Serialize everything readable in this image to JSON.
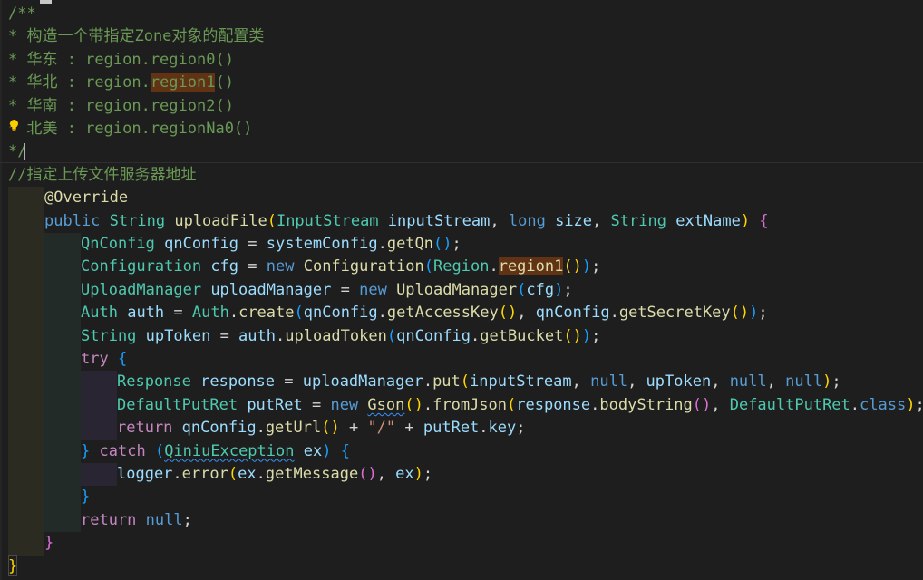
{
  "colors": {
    "background": "#1e1e1e",
    "comment": "#6a9955",
    "keyword": "#569cd6",
    "control": "#c586c0",
    "type": "#4ec9b0",
    "function": "#dcdcaa",
    "variable": "#9cdcfe",
    "string": "#ce9178",
    "bracket_1": "#ffd700",
    "bracket_2": "#da70d6",
    "bracket_3": "#179fff",
    "highlight": "#613214"
  },
  "icons": {
    "lightbulb": "lightbulb-icon",
    "cursor": "text-cursor"
  },
  "code": {
    "lines": [
      {
        "i": 0,
        "tokens": [
          {
            "t": "/**",
            "c": "comment"
          }
        ]
      },
      {
        "i": 0,
        "tokens": [
          {
            "t": "* 构造一个带指定Zone对象的配置类",
            "c": "comment"
          }
        ]
      },
      {
        "i": 0,
        "tokens": [
          {
            "t": "* 华东 : region.region0()",
            "c": "comment"
          }
        ]
      },
      {
        "i": 0,
        "tokens": [
          {
            "t": "* 华北 : region.",
            "c": "comment"
          },
          {
            "t": "region1",
            "c": "comment",
            "hl": true
          },
          {
            "t": "()",
            "c": "comment"
          }
        ]
      },
      {
        "i": 0,
        "tokens": [
          {
            "t": "* 华南 : region.region2()",
            "c": "comment"
          }
        ]
      },
      {
        "i": 0,
        "tokens": [
          {
            "t": "* 北美 : region.regionNa0()",
            "c": "comment"
          }
        ]
      },
      {
        "i": 0,
        "tokens": [
          {
            "t": "*/",
            "c": "comment"
          }
        ]
      },
      {
        "i": 0,
        "tokens": [
          {
            "t": "//指定上传文件服务器地址",
            "c": "comment"
          }
        ]
      },
      {
        "i": 1,
        "tokens": [
          {
            "t": "@Override",
            "c": "anno"
          }
        ]
      },
      {
        "i": 1,
        "tokens": [
          {
            "t": "public",
            "c": "kw"
          },
          {
            "t": " "
          },
          {
            "t": "String",
            "c": "type"
          },
          {
            "t": " "
          },
          {
            "t": "uploadFile",
            "c": "fn"
          },
          {
            "t": "(",
            "c": "p1"
          },
          {
            "t": "InputStream",
            "c": "type"
          },
          {
            "t": " "
          },
          {
            "t": "inputStream",
            "c": "var"
          },
          {
            "t": ", "
          },
          {
            "t": "long",
            "c": "kw"
          },
          {
            "t": " "
          },
          {
            "t": "size",
            "c": "var"
          },
          {
            "t": ", "
          },
          {
            "t": "String",
            "c": "type"
          },
          {
            "t": " "
          },
          {
            "t": "extName",
            "c": "var"
          },
          {
            "t": ")",
            "c": "p1"
          },
          {
            "t": " "
          },
          {
            "t": "{",
            "c": "p2"
          }
        ]
      },
      {
        "i": 2,
        "tokens": [
          {
            "t": "QnConfig",
            "c": "type"
          },
          {
            "t": " "
          },
          {
            "t": "qnConfig",
            "c": "var"
          },
          {
            "t": " = "
          },
          {
            "t": "systemConfig",
            "c": "var"
          },
          {
            "t": "."
          },
          {
            "t": "getQn",
            "c": "fn"
          },
          {
            "t": "()",
            "c": "p3"
          },
          {
            "t": ";"
          }
        ]
      },
      {
        "i": 2,
        "tokens": [
          {
            "t": "Configuration",
            "c": "type"
          },
          {
            "t": " "
          },
          {
            "t": "cfg",
            "c": "var"
          },
          {
            "t": " = "
          },
          {
            "t": "new",
            "c": "kw"
          },
          {
            "t": " "
          },
          {
            "t": "Configuration",
            "c": "fn"
          },
          {
            "t": "(",
            "c": "p3"
          },
          {
            "t": "Region",
            "c": "type"
          },
          {
            "t": "."
          },
          {
            "t": "region1",
            "c": "fn",
            "hl": true
          },
          {
            "t": "()",
            "c": "p1"
          },
          {
            "t": ")",
            "c": "p3"
          },
          {
            "t": ";"
          }
        ]
      },
      {
        "i": 2,
        "tokens": [
          {
            "t": "UploadManager",
            "c": "type"
          },
          {
            "t": " "
          },
          {
            "t": "uploadManager",
            "c": "var"
          },
          {
            "t": " = "
          },
          {
            "t": "new",
            "c": "kw"
          },
          {
            "t": " "
          },
          {
            "t": "UploadManager",
            "c": "fn"
          },
          {
            "t": "(",
            "c": "p3"
          },
          {
            "t": "cfg",
            "c": "var"
          },
          {
            "t": ")",
            "c": "p3"
          },
          {
            "t": ";"
          }
        ]
      },
      {
        "i": 2,
        "tokens": [
          {
            "t": "Auth",
            "c": "type"
          },
          {
            "t": " "
          },
          {
            "t": "auth",
            "c": "var"
          },
          {
            "t": " = "
          },
          {
            "t": "Auth",
            "c": "type"
          },
          {
            "t": "."
          },
          {
            "t": "create",
            "c": "fn"
          },
          {
            "t": "(",
            "c": "p3"
          },
          {
            "t": "qnConfig",
            "c": "var"
          },
          {
            "t": "."
          },
          {
            "t": "getAccessKey",
            "c": "fn"
          },
          {
            "t": "()",
            "c": "p1"
          },
          {
            "t": ", "
          },
          {
            "t": "qnConfig",
            "c": "var"
          },
          {
            "t": "."
          },
          {
            "t": "getSecretKey",
            "c": "fn"
          },
          {
            "t": "()",
            "c": "p1"
          },
          {
            "t": ")",
            "c": "p3"
          },
          {
            "t": ";"
          }
        ]
      },
      {
        "i": 2,
        "tokens": [
          {
            "t": "String",
            "c": "type"
          },
          {
            "t": " "
          },
          {
            "t": "upToken",
            "c": "var"
          },
          {
            "t": " = "
          },
          {
            "t": "auth",
            "c": "var"
          },
          {
            "t": "."
          },
          {
            "t": "uploadToken",
            "c": "fn"
          },
          {
            "t": "(",
            "c": "p3"
          },
          {
            "t": "qnConfig",
            "c": "var"
          },
          {
            "t": "."
          },
          {
            "t": "getBucket",
            "c": "fn"
          },
          {
            "t": "()",
            "c": "p1"
          },
          {
            "t": ")",
            "c": "p3"
          },
          {
            "t": ";"
          }
        ]
      },
      {
        "i": 2,
        "tokens": [
          {
            "t": "try",
            "c": "ctrl"
          },
          {
            "t": " "
          },
          {
            "t": "{",
            "c": "p3"
          }
        ]
      },
      {
        "i": 3,
        "tokens": [
          {
            "t": "Response",
            "c": "type"
          },
          {
            "t": " "
          },
          {
            "t": "response",
            "c": "var"
          },
          {
            "t": " = "
          },
          {
            "t": "uploadManager",
            "c": "var"
          },
          {
            "t": "."
          },
          {
            "t": "put",
            "c": "fn"
          },
          {
            "t": "(",
            "c": "p1"
          },
          {
            "t": "inputStream",
            "c": "var"
          },
          {
            "t": ", "
          },
          {
            "t": "null",
            "c": "kw"
          },
          {
            "t": ", "
          },
          {
            "t": "upToken",
            "c": "var"
          },
          {
            "t": ", "
          },
          {
            "t": "null",
            "c": "kw"
          },
          {
            "t": ", "
          },
          {
            "t": "null",
            "c": "kw"
          },
          {
            "t": ")",
            "c": "p1"
          },
          {
            "t": ";"
          }
        ]
      },
      {
        "i": 3,
        "tokens": [
          {
            "t": "DefaultPutRet",
            "c": "type"
          },
          {
            "t": " "
          },
          {
            "t": "putRet",
            "c": "var"
          },
          {
            "t": " = "
          },
          {
            "t": "new",
            "c": "kw"
          },
          {
            "t": " "
          },
          {
            "t": "Gson",
            "c": "fn",
            "sq": true
          },
          {
            "t": "()",
            "c": "p1"
          },
          {
            "t": "."
          },
          {
            "t": "fromJson",
            "c": "fn"
          },
          {
            "t": "(",
            "c": "p1"
          },
          {
            "t": "response",
            "c": "var"
          },
          {
            "t": "."
          },
          {
            "t": "bodyString",
            "c": "fn"
          },
          {
            "t": "()",
            "c": "p2"
          },
          {
            "t": ", "
          },
          {
            "t": "DefaultPutRet",
            "c": "type"
          },
          {
            "t": "."
          },
          {
            "t": "class",
            "c": "kw"
          },
          {
            "t": ")",
            "c": "p1"
          },
          {
            "t": ";"
          }
        ]
      },
      {
        "i": 3,
        "tokens": [
          {
            "t": "return",
            "c": "ctrl"
          },
          {
            "t": " "
          },
          {
            "t": "qnConfig",
            "c": "var"
          },
          {
            "t": "."
          },
          {
            "t": "getUrl",
            "c": "fn"
          },
          {
            "t": "()",
            "c": "p1"
          },
          {
            "t": " + "
          },
          {
            "t": "\"/\"",
            "c": "str"
          },
          {
            "t": " + "
          },
          {
            "t": "putRet",
            "c": "var"
          },
          {
            "t": "."
          },
          {
            "t": "key",
            "c": "var"
          },
          {
            "t": ";"
          }
        ]
      },
      {
        "i": 2,
        "tokens": [
          {
            "t": "}",
            "c": "p3"
          },
          {
            "t": " "
          },
          {
            "t": "catch",
            "c": "ctrl"
          },
          {
            "t": " "
          },
          {
            "t": "(",
            "c": "p3"
          },
          {
            "t": "QiniuException",
            "c": "type",
            "sq": true
          },
          {
            "t": " "
          },
          {
            "t": "ex",
            "c": "var"
          },
          {
            "t": ")",
            "c": "p3"
          },
          {
            "t": " "
          },
          {
            "t": "{",
            "c": "p3"
          }
        ]
      },
      {
        "i": 3,
        "tokens": [
          {
            "t": "logger",
            "c": "var"
          },
          {
            "t": "."
          },
          {
            "t": "error",
            "c": "fn"
          },
          {
            "t": "(",
            "c": "p1"
          },
          {
            "t": "ex",
            "c": "var"
          },
          {
            "t": "."
          },
          {
            "t": "getMessage",
            "c": "fn"
          },
          {
            "t": "()",
            "c": "p2"
          },
          {
            "t": ", "
          },
          {
            "t": "ex",
            "c": "var"
          },
          {
            "t": ")",
            "c": "p1"
          },
          {
            "t": ";"
          }
        ]
      },
      {
        "i": 2,
        "tokens": [
          {
            "t": "}",
            "c": "p3"
          }
        ]
      },
      {
        "i": 2,
        "tokens": [
          {
            "t": "return",
            "c": "ctrl"
          },
          {
            "t": " "
          },
          {
            "t": "null",
            "c": "kw"
          },
          {
            "t": ";"
          }
        ]
      },
      {
        "i": 1,
        "tokens": [
          {
            "t": "}",
            "c": "p2"
          }
        ]
      },
      {
        "i": 0,
        "tokens": [
          {
            "t": "}",
            "c": "p1"
          }
        ]
      }
    ]
  }
}
